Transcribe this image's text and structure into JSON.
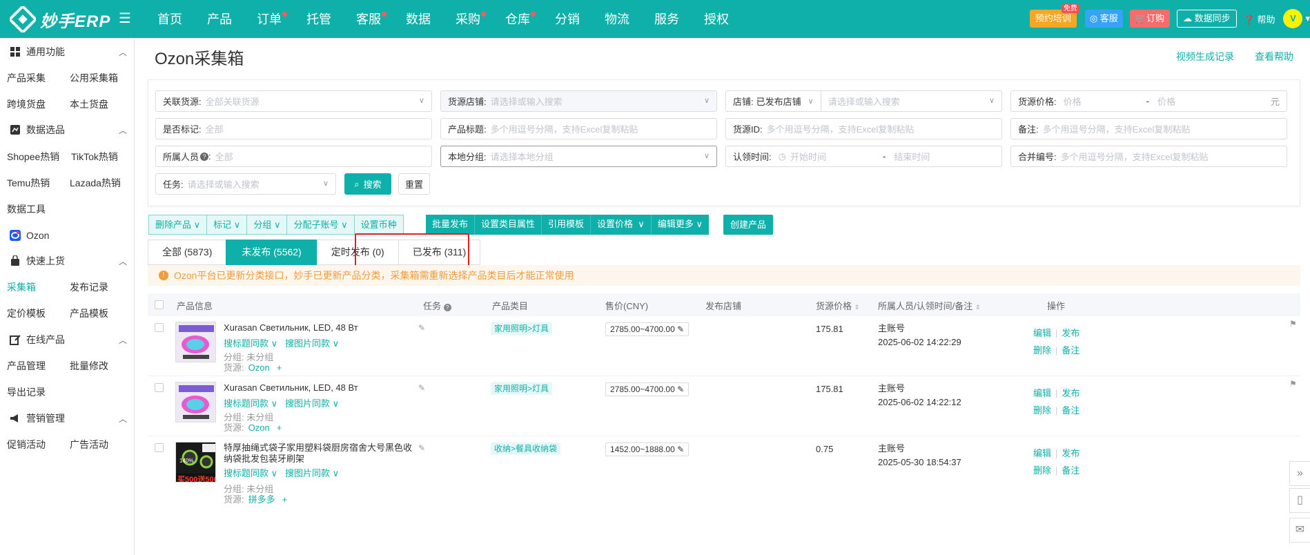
{
  "app": {
    "logo_text": "妙手ERP"
  },
  "nav": {
    "items": [
      {
        "label": "首页",
        "dot": false
      },
      {
        "label": "产品",
        "dot": false
      },
      {
        "label": "订单",
        "dot": true
      },
      {
        "label": "托管",
        "dot": false
      },
      {
        "label": "客服",
        "dot": true
      },
      {
        "label": "数据",
        "dot": false
      },
      {
        "label": "采购",
        "dot": true
      },
      {
        "label": "仓库",
        "dot": true
      },
      {
        "label": "分销",
        "dot": false
      },
      {
        "label": "物流",
        "dot": false
      },
      {
        "label": "服务",
        "dot": false
      },
      {
        "label": "授权",
        "dot": false
      }
    ],
    "training_label": "预约培训",
    "training_badge": "免费",
    "kefu_label": "客服",
    "order_label": "订购",
    "sync_label": "数据同步",
    "help_label": "帮助",
    "avatar_text": "V"
  },
  "sidebar": {
    "sections": [
      {
        "title": "通用功能",
        "links": [
          "产品采集",
          "公用采集箱",
          "跨境货盘",
          "本土货盘"
        ]
      },
      {
        "title": "数据选品",
        "links": [
          "Shopee热销",
          "TikTok热销",
          "Temu热销",
          "Lazada热销",
          "数据工具"
        ]
      },
      {
        "title": "Ozon",
        "links": []
      },
      {
        "title": "快速上货",
        "links": [
          "采集箱",
          "发布记录",
          "定价模板",
          "产品模板"
        ]
      },
      {
        "title": "在线产品",
        "links": [
          "产品管理",
          "批量修改",
          "导出记录"
        ]
      },
      {
        "title": "营销管理",
        "links": [
          "促销活动",
          "广告活动"
        ]
      }
    ]
  },
  "page": {
    "title": "Ozon采集箱",
    "link_video": "视频生成记录",
    "link_help": "查看帮助"
  },
  "filters": {
    "source": {
      "label": "关联货源:",
      "placeholder": "全部关联货源"
    },
    "source_shop": {
      "label": "货源店铺:",
      "placeholder": "请选择或输入搜索"
    },
    "shop": {
      "label": "店铺:",
      "value": "已发布店铺",
      "placeholder": "请选择或输入搜索"
    },
    "source_price": {
      "label": "货源价格:",
      "ph_min": "价格",
      "dash": "-",
      "ph_max": "价格",
      "unit": "元"
    },
    "marked": {
      "label": "是否标记:",
      "placeholder": "全部"
    },
    "product_title": {
      "label": "产品标题:",
      "placeholder": "多个用逗号分隔，支持Excel复制粘贴"
    },
    "source_id": {
      "label": "货源ID:",
      "placeholder": "多个用逗号分隔，支持Excel复制粘贴"
    },
    "remark": {
      "label": "备注:",
      "placeholder": "多个用逗号分隔，支持Excel复制粘贴"
    },
    "owner": {
      "label": "所属人员",
      "placeholder": "全部"
    },
    "local_group": {
      "label": "本地分组:",
      "placeholder": "请选择本地分组"
    },
    "claim_time": {
      "label": "认领时间:",
      "ph_start": "开始时间",
      "dash": "-",
      "ph_end": "结束时间"
    },
    "merge_no": {
      "label": "合并编号:",
      "placeholder": "多个用逗号分隔，支持Excel复制粘贴"
    },
    "task": {
      "label": "任务:",
      "placeholder": "请选择或输入搜索"
    },
    "search_label": "搜索",
    "reset_label": "重置"
  },
  "actions": {
    "light": [
      "删除产品",
      "标记",
      "分组",
      "分配子账号",
      "设置币种"
    ],
    "dark": [
      "批量发布",
      "设置类目属性",
      "引用模板",
      "设置价格",
      "编辑更多"
    ],
    "create": "创建产品"
  },
  "tabs": [
    {
      "label": "全部 (5873)",
      "active": false
    },
    {
      "label": "未发布 (5562)",
      "active": true
    },
    {
      "label": "定时发布 (0)",
      "active": false
    },
    {
      "label": "已发布 (311)",
      "active": false
    }
  ],
  "notice": "Ozon平台已更新分类接口，妙手已更新产品分类，采集箱需重新选择产品类目后才能正常使用",
  "table": {
    "headers": {
      "info": "产品信息",
      "task": "任务",
      "category": "产品类目",
      "price": "售价(CNY)",
      "shop": "发布店铺",
      "source_price": "货源价格",
      "owner": "所属人员/认领时间/备注",
      "ops": "操作"
    },
    "rows": [
      {
        "title": "Xurasan Светильник, LED, 48 Вт",
        "same_title": "搜标题同款",
        "same_image": "搜图片同款",
        "group": "分组: 未分组",
        "source_label": "货源:",
        "source": "Ozon",
        "category": "家用照明>灯具",
        "price": "2785.00~4700.00",
        "source_price": "175.81",
        "owner": "主账号",
        "time": "2025-06-02 14:22:29",
        "ops": [
          "编辑",
          "发布",
          "删除",
          "备注"
        ]
      },
      {
        "title": "Xurasan Светильник, LED, 48 Вт",
        "same_title": "搜标题同款",
        "same_image": "搜图片同款",
        "group": "分组: 未分组",
        "source_label": "货源:",
        "source": "Ozon",
        "category": "家用照明>灯具",
        "price": "2785.00~4700.00",
        "source_price": "175.81",
        "owner": "主账号",
        "time": "2025-06-02 14:22:12",
        "ops": [
          "编辑",
          "发布",
          "删除",
          "备注"
        ]
      },
      {
        "title": "特厚抽绳式袋子家用塑料袋厨房宿舍大号黑色收纳袋批发包装牙刷架",
        "same_title": "搜标题同款",
        "same_image": "搜图片同款",
        "group": "分组: 未分组",
        "source_label": "货源:",
        "source": "拼多多",
        "category": "收纳>餐具收纳袋",
        "price": "1452.00~1888.00",
        "source_price": "0.75",
        "owner": "主账号",
        "time": "2025-05-30 18:54:37",
        "ops": [
          "编辑",
          "发布",
          "删除",
          "备注"
        ]
      }
    ],
    "thumb_text": [
      "140%",
      "买500送500"
    ]
  },
  "colors": {
    "brand": "#0fb0a9",
    "notice": "#f29b38",
    "danger": "#e02020"
  }
}
